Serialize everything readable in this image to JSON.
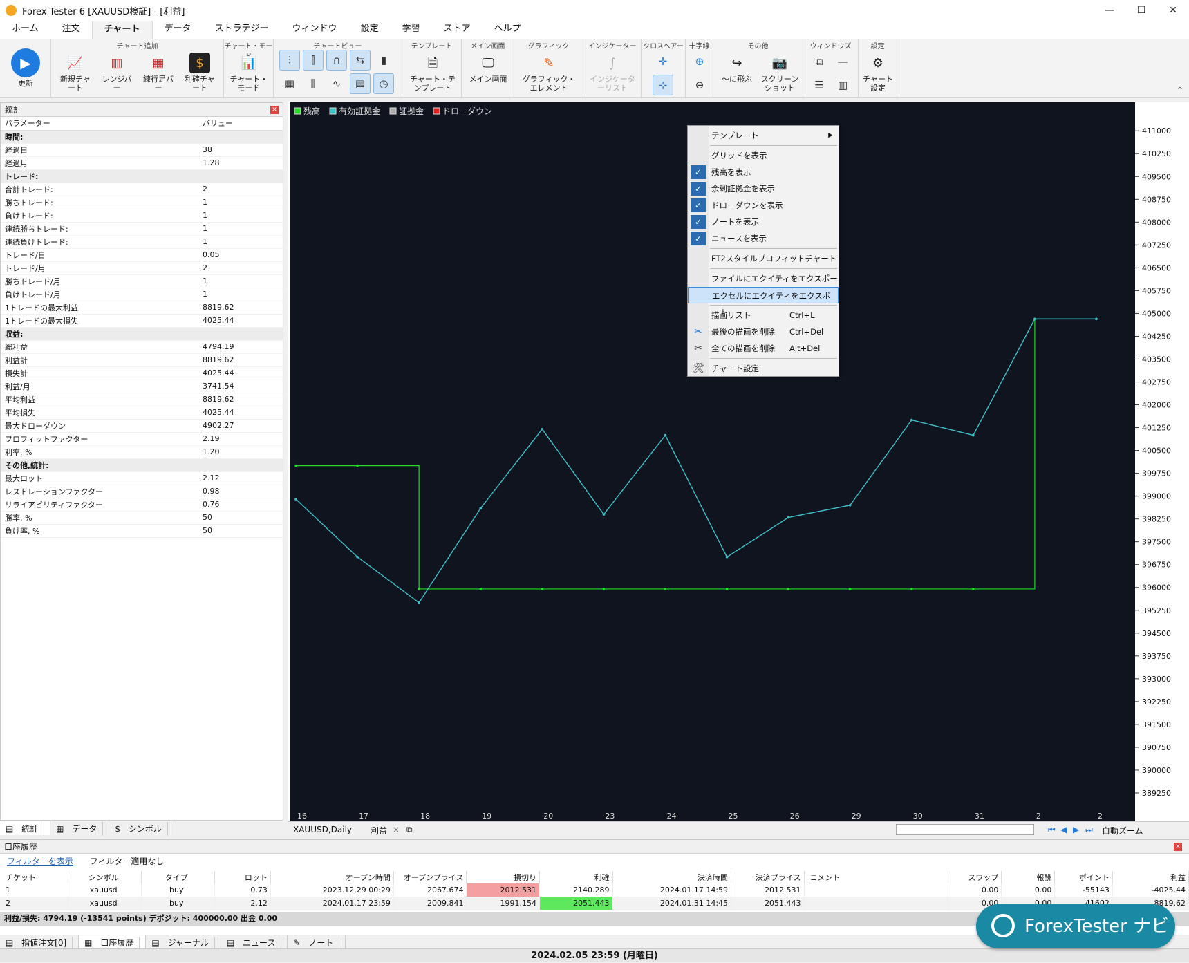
{
  "window": {
    "title": "Forex Tester 6  [XAUUSD検証] - [利益]",
    "minimize": "—",
    "maximize": "☐",
    "close": "✕"
  },
  "menu_tabs": [
    "ホーム",
    "注文",
    "チャート",
    "データ",
    "ストラテジー",
    "ウィンドウ",
    "設定",
    "学習",
    "ストア",
    "ヘルプ"
  ],
  "ribbon": {
    "refresh_label": "更新",
    "group_chart_add": "チャート追加",
    "new_chart": "新規チャート",
    "range_bar": "レンジバー",
    "renko_bar": "練行足バー",
    "profit_chart": "利確チャート",
    "group_chart_mode": "チャート・モード",
    "chart_mode": "チャート・モード",
    "group_chart_view": "チャートビュー",
    "group_template": "テンプレート",
    "chart_template": "チャート・テンプレート",
    "group_main_screen": "メイン画面",
    "main_screen": "メイン画面",
    "group_graphic": "グラフィック",
    "graphic_element": "グラフィック・エレメント",
    "group_indicator": "インジケーター",
    "indicator_list": "インジケーターリスト",
    "group_crosshair": "クロスヘアー",
    "group_cross": "十字線",
    "group_other": "その他",
    "jump_to": "〜に飛ぶ",
    "screenshot": "スクリーンショット",
    "group_window": "ウィンドウズ",
    "group_settings": "設定",
    "chart_settings": "チャート設定"
  },
  "stats_panel": {
    "title": "統計",
    "col_param": "パラメーター",
    "col_value": "バリュー",
    "rows": [
      {
        "type": "sect",
        "k": "時間:",
        "v": ""
      },
      {
        "type": "row",
        "k": "経過日",
        "v": "38"
      },
      {
        "type": "row",
        "k": "経過月",
        "v": "1.28"
      },
      {
        "type": "sect",
        "k": "トレード:",
        "v": ""
      },
      {
        "type": "row",
        "k": "合計トレード:",
        "v": "2"
      },
      {
        "type": "row",
        "k": "勝ちトレード:",
        "v": "1"
      },
      {
        "type": "row",
        "k": "負けトレード:",
        "v": "1"
      },
      {
        "type": "row",
        "k": "連続勝ちトレード:",
        "v": "1"
      },
      {
        "type": "row",
        "k": "連続負けトレード:",
        "v": "1"
      },
      {
        "type": "row",
        "k": "トレード/日",
        "v": "0.05"
      },
      {
        "type": "row",
        "k": "トレード/月",
        "v": "2"
      },
      {
        "type": "row",
        "k": "勝ちトレード/月",
        "v": "1"
      },
      {
        "type": "row",
        "k": "負けトレード/月",
        "v": "1"
      },
      {
        "type": "row",
        "k": "1トレードの最大利益",
        "v": "8819.62"
      },
      {
        "type": "row",
        "k": "1トレードの最大損失",
        "v": "4025.44"
      },
      {
        "type": "sect",
        "k": "収益:",
        "v": ""
      },
      {
        "type": "row",
        "k": "総利益",
        "v": "4794.19"
      },
      {
        "type": "row",
        "k": "利益計",
        "v": "8819.62"
      },
      {
        "type": "row",
        "k": "損失計",
        "v": "4025.44"
      },
      {
        "type": "row",
        "k": "利益/月",
        "v": "3741.54"
      },
      {
        "type": "row",
        "k": "平均利益",
        "v": "8819.62"
      },
      {
        "type": "row",
        "k": "平均損失",
        "v": "4025.44"
      },
      {
        "type": "row",
        "k": "最大ドローダウン",
        "v": "4902.27"
      },
      {
        "type": "row",
        "k": "プロフィットファクター",
        "v": "2.19"
      },
      {
        "type": "row",
        "k": "利率, %",
        "v": "1.20"
      },
      {
        "type": "sect",
        "k": "その他,統計:",
        "v": ""
      },
      {
        "type": "row",
        "k": "最大ロット",
        "v": "2.12"
      },
      {
        "type": "row",
        "k": "レストレーションファクター",
        "v": "0.98"
      },
      {
        "type": "row",
        "k": "リライアビリティファクター",
        "v": "0.76"
      },
      {
        "type": "row",
        "k": "勝率, %",
        "v": "50"
      },
      {
        "type": "row",
        "k": "負け率, %",
        "v": "50"
      }
    ],
    "tabs": [
      "統計",
      "データ",
      "シンボル"
    ]
  },
  "chart": {
    "legend": [
      {
        "label": "残高",
        "color": "#22dd22"
      },
      {
        "label": "有効証拠金",
        "color": "#3fc1c9"
      },
      {
        "label": "証拠金",
        "color": "#aaaaaa"
      },
      {
        "label": "ドローダウン",
        "color": "#dd2222"
      }
    ],
    "y_ticks": [
      "411000",
      "410250",
      "409500",
      "408750",
      "408000",
      "407250",
      "406500",
      "405750",
      "405000",
      "404250",
      "403500",
      "402750",
      "402000",
      "401250",
      "400500",
      "399750",
      "399000",
      "398250",
      "397500",
      "396750",
      "396000",
      "395250",
      "394500",
      "393750",
      "393000",
      "392250",
      "391500",
      "390750",
      "390000",
      "389250"
    ],
    "x_ticks": [
      "16",
      "17",
      "18",
      "19",
      "20",
      "23",
      "24",
      "25",
      "26",
      "29",
      "30",
      "31",
      "2",
      "2"
    ],
    "tab_symbol": "XAUUSD,Daily",
    "tab_profit": "利益",
    "auto_zoom": "自動ズーム"
  },
  "chart_data": {
    "type": "line",
    "xlabel": "",
    "ylabel": "",
    "ylim": [
      389000,
      411300
    ],
    "series": [
      {
        "name": "残高",
        "values": [
          400000,
          400000,
          395950,
          395950,
          395950,
          395950,
          395950,
          395950,
          395950,
          395950,
          395950,
          395950,
          404819.62,
          404819.62
        ]
      },
      {
        "name": "有効証拠金",
        "values": [
          398900,
          397000,
          395500,
          398600,
          401200,
          398400,
          401000,
          397000,
          398300,
          398700,
          401500,
          401000,
          404819.62,
          404819.62
        ]
      }
    ],
    "x": [
      "16",
      "17",
      "18",
      "19",
      "20",
      "23",
      "24",
      "25",
      "26",
      "29",
      "30",
      "31",
      "2",
      "2"
    ]
  },
  "context_menu": {
    "template": "テンプレート",
    "show_grid": "グリッドを表示",
    "show_balance": "残高を表示",
    "show_free_margin": "余剰証拠金を表示",
    "show_drawdown": "ドローダウンを表示",
    "show_notes": "ノートを表示",
    "show_news": "ニュースを表示",
    "ft2_profit": "FT2スタイルプロフィットチャート",
    "export_file": "ファイルにエクイティをエクスポート",
    "export_excel": "エクセルにエクイティをエクスポート",
    "draw_list": "描画リスト",
    "draw_list_sc": "Ctrl+L",
    "delete_last": "最後の描画を削除",
    "delete_last_sc": "Ctrl+Del",
    "delete_all": "全ての描画を削除",
    "delete_all_sc": "Alt+Del",
    "chart_settings": "チャート設定"
  },
  "history": {
    "title": "口座履歴",
    "show_filter": "フィルターを表示",
    "no_filter": "フィルター適用なし",
    "columns": [
      "チケット",
      "シンボル",
      "タイプ",
      "ロット",
      "オープン時間",
      "オープンプライス",
      "損切り",
      "利確",
      "決済時間",
      "決済プライス",
      "コメント",
      "スワップ",
      "報酬",
      "ポイント",
      "利益"
    ],
    "rows": [
      [
        "1",
        "xauusd",
        "buy",
        "0.73",
        "2023.12.29 00:29",
        "2067.674",
        "2012.531",
        "2140.289",
        "2024.01.17 14:59",
        "2012.531",
        "",
        "0.00",
        "0.00",
        "-55143",
        "-4025.44"
      ],
      [
        "2",
        "xauusd",
        "buy",
        "2.12",
        "2024.01.17 23:59",
        "2009.841",
        "1991.154",
        "2051.443",
        "2024.01.31 14:45",
        "2051.443",
        "",
        "0.00",
        "0.00",
        "41602",
        "8819.62"
      ]
    ],
    "summary": "利益/損失: 4794.19 (-13541 points) デポジット: 400000.00 出金 0.00"
  },
  "bottom_tabs": [
    "指値注文[0]",
    "口座履歴",
    "ジャーナル",
    "ニュース",
    "ノート"
  ],
  "status": "2024.02.05 23:59 (月曜日)",
  "badge": "ForexTester ナビ"
}
